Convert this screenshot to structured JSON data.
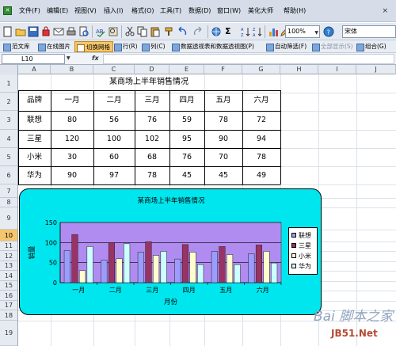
{
  "menubar": {
    "items": [
      "文件(F)",
      "编辑(E)",
      "视图(V)",
      "插入(I)",
      "格式(O)",
      "工具(T)",
      "数据(D)",
      "窗口(W)",
      "美化大师",
      "帮助(H)"
    ],
    "close_glyph": "×"
  },
  "toolbar": {
    "zoom": "100%",
    "font": "宋体",
    "sigma_label": "Σ"
  },
  "toolbar2": {
    "items": [
      "范文库",
      "在线图片",
      "切换网格",
      "行(R)",
      "列(C)",
      "数据透视表和数据透视图(P)",
      "自动筛选(F)",
      "全部显示(S)",
      "组合(G)"
    ]
  },
  "formula": {
    "cell_ref": "L10",
    "fx_label": "fx",
    "value": ""
  },
  "columns": [
    "A",
    "B",
    "C",
    "D",
    "E",
    "F",
    "G",
    "H",
    "I",
    "J"
  ],
  "rows": [
    "1",
    "2",
    "3",
    "4",
    "5",
    "6",
    "7",
    "8",
    "9",
    "10",
    "11",
    "12",
    "13",
    "14",
    "15",
    "16",
    "17",
    "18",
    "19"
  ],
  "selected_row": "10",
  "sheet": {
    "title": "某商场上半年销售情况",
    "header": [
      "品牌",
      "一月",
      "二月",
      "三月",
      "四月",
      "五月",
      "六月"
    ],
    "rows": [
      [
        "联想",
        "80",
        "56",
        "76",
        "59",
        "78",
        "72"
      ],
      [
        "三星",
        "120",
        "100",
        "102",
        "95",
        "90",
        "94"
      ],
      [
        "小米",
        "30",
        "60",
        "68",
        "76",
        "70",
        "78"
      ],
      [
        "华为",
        "90",
        "97",
        "78",
        "45",
        "45",
        "49"
      ]
    ]
  },
  "chart_data": {
    "type": "bar",
    "title": "某商场上半年销售情况",
    "xlabel": "月份",
    "ylabel": "销量",
    "categories": [
      "一月",
      "二月",
      "三月",
      "四月",
      "五月",
      "六月"
    ],
    "ylim": [
      0,
      150
    ],
    "yticks": [
      "0",
      "50",
      "100",
      "150"
    ],
    "grid": true,
    "legend": "right",
    "plot_background": "#b08cf0",
    "series": [
      {
        "name": "联想",
        "color": "#9c9cff",
        "values": [
          80,
          56,
          76,
          59,
          78,
          72
        ]
      },
      {
        "name": "三星",
        "color": "#993366",
        "values": [
          120,
          100,
          102,
          95,
          90,
          94
        ]
      },
      {
        "name": "小米",
        "color": "#ffffcc",
        "values": [
          30,
          60,
          68,
          76,
          70,
          78
        ]
      },
      {
        "name": "华为",
        "color": "#ccffff",
        "values": [
          90,
          97,
          78,
          45,
          45,
          49
        ]
      }
    ]
  },
  "watermark": {
    "line1": "Bai 脚本之家",
    "line2": "JB51.Net"
  },
  "colors": {
    "chart_area": "#00e6ee",
    "selected_row_header": "#f7c56b"
  }
}
